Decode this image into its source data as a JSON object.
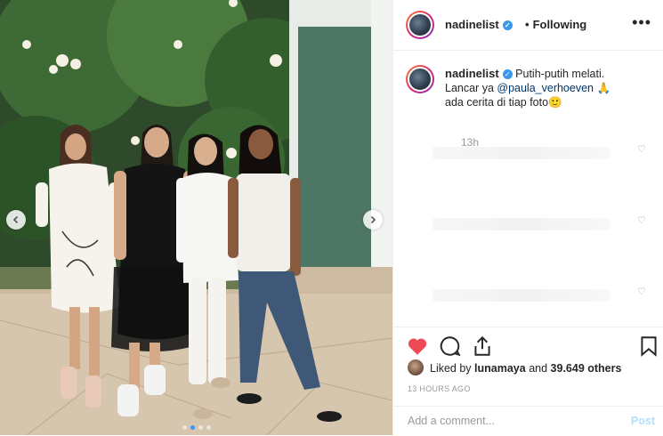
{
  "header": {
    "username": "nadinelist",
    "separator": "•",
    "follow_status": "Following",
    "more_icon": "ellipsis-icon"
  },
  "caption": {
    "username": "nadinelist",
    "text_part1": "Putih-putih melati.",
    "text_part2": "Lancar ya",
    "mention": "@paula_verhoeven",
    "emoji_pray": "🙏",
    "text_part3": "ada cerita di tiap foto",
    "emoji_smile": "🙂",
    "time": "13h"
  },
  "likes": {
    "prefix": "Liked by",
    "liker": "lunamaya",
    "connector": "and",
    "count": "39.649 others"
  },
  "timestamp": "13 HOURS AGO",
  "comment_box": {
    "placeholder": "Add a comment...",
    "post_label": "Post"
  },
  "carousel": {
    "total": 4,
    "current": 2
  },
  "colors": {
    "like_red": "#ed4956",
    "verified_blue": "#3897f0",
    "post_disabled": "#b2dffc"
  }
}
